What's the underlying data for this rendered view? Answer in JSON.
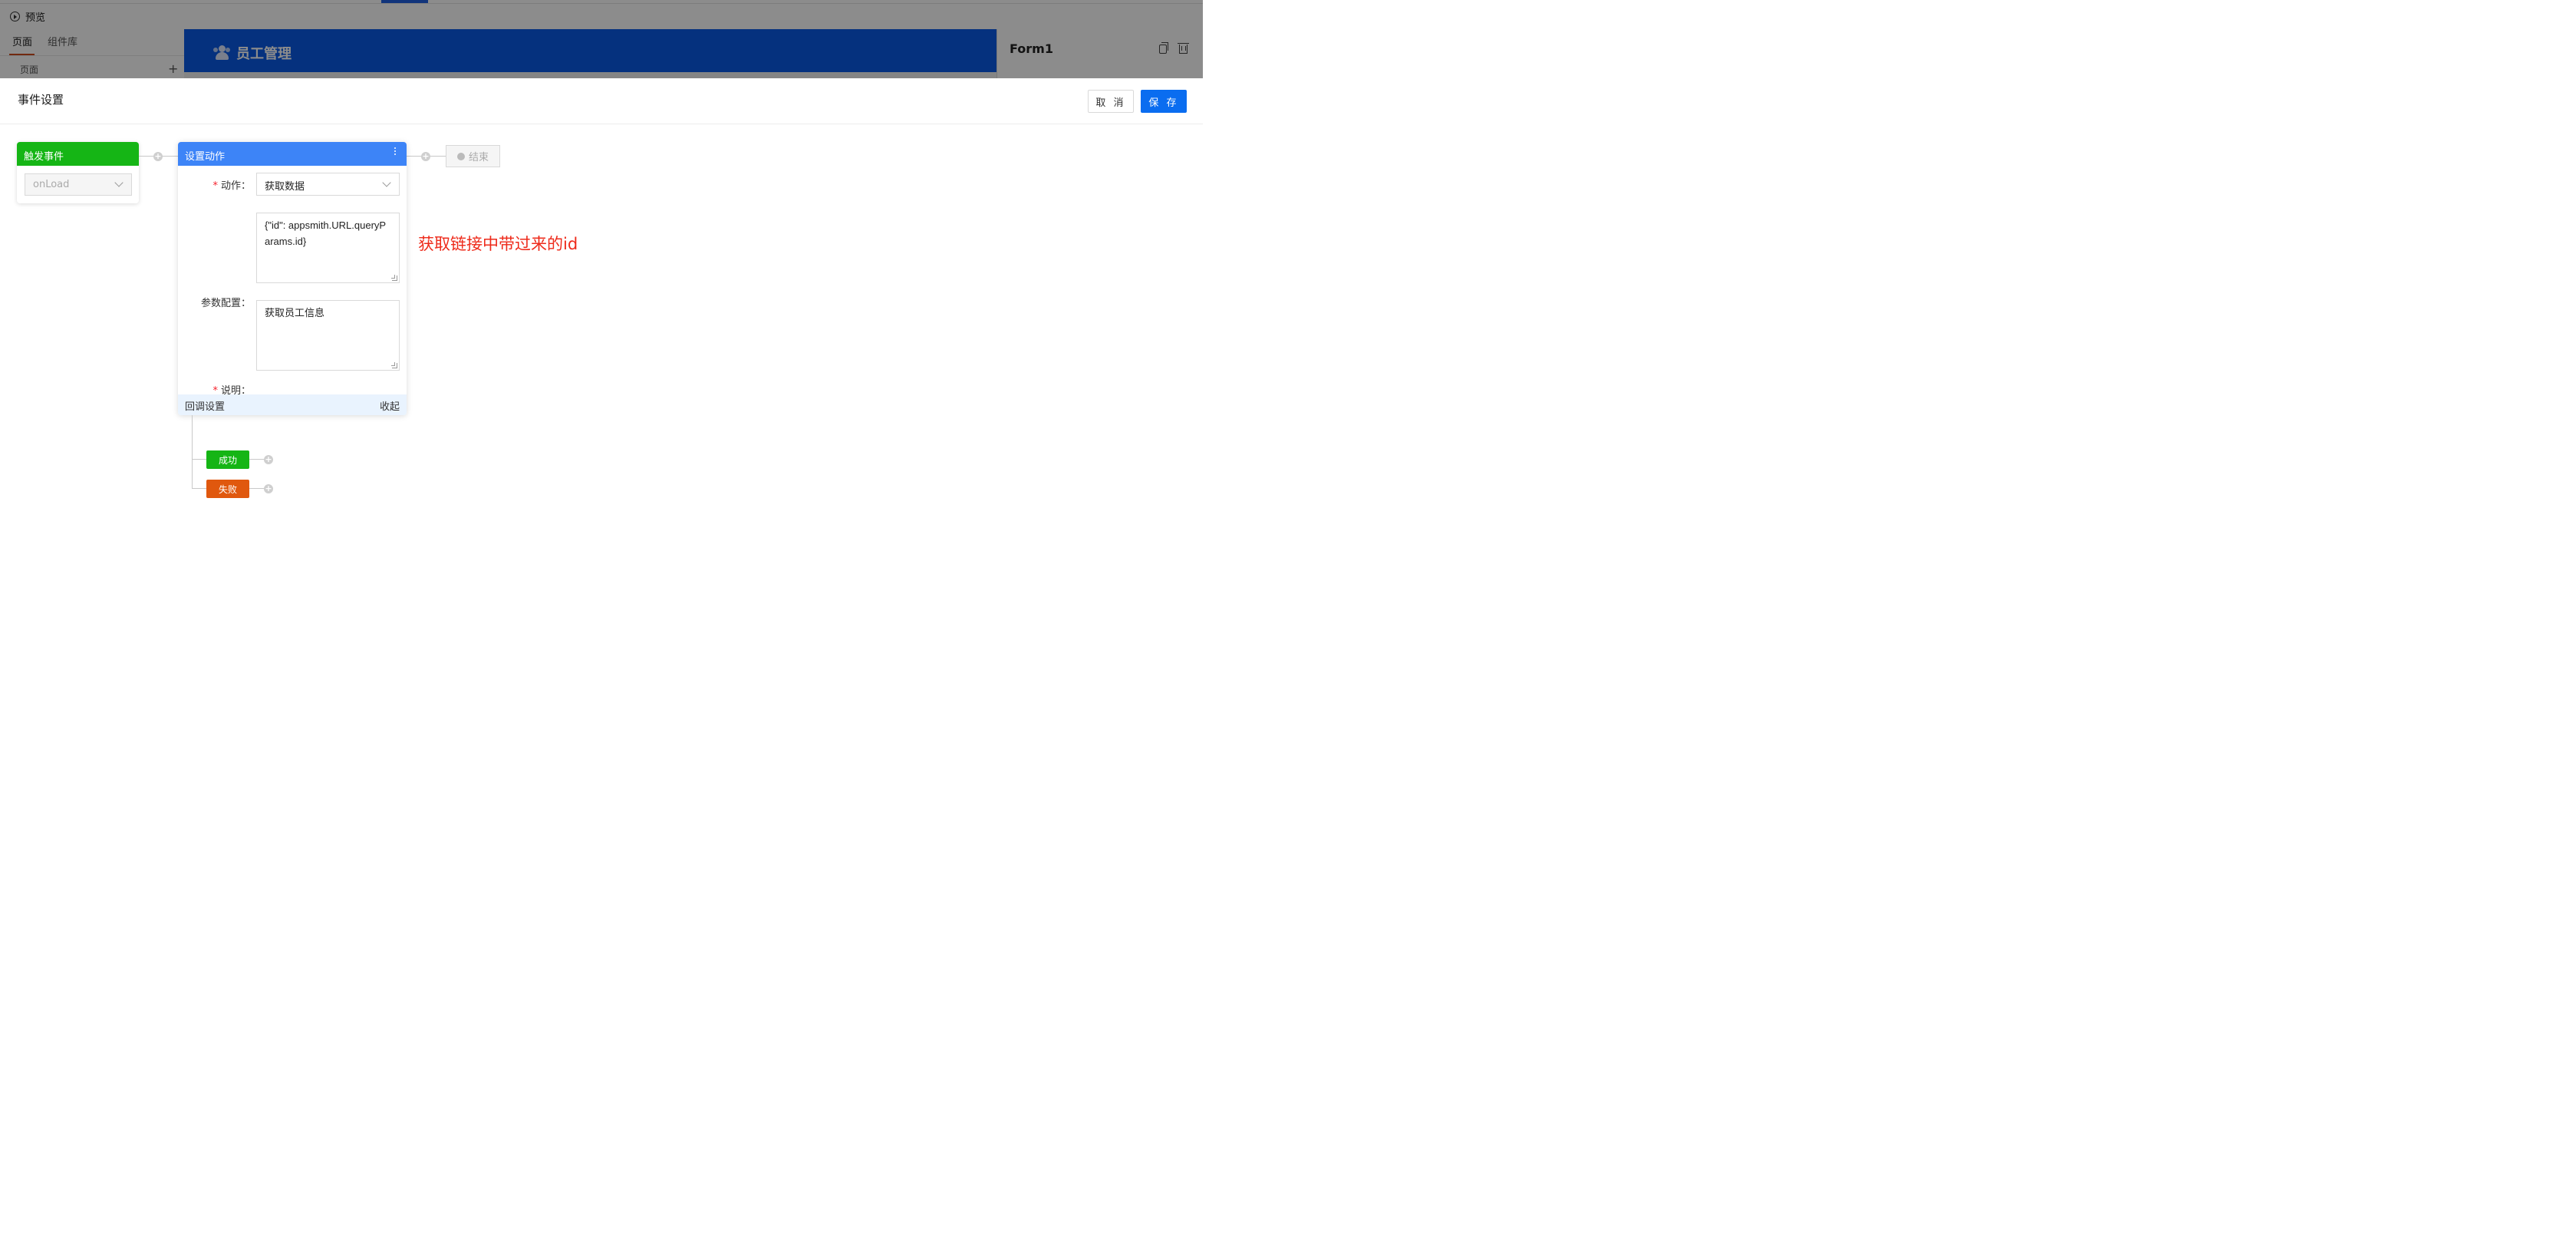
{
  "background": {
    "preview_label": "预览",
    "tabs": [
      "页面",
      "组件库"
    ],
    "pages_label": "页面",
    "add_symbol": "+",
    "canvas_title": "员工管理",
    "panel_title": "Form1"
  },
  "drawer": {
    "title": "事件设置",
    "cancel_label": "取 消",
    "save_label": "保 存"
  },
  "trigger": {
    "header": "触发事件",
    "event_value": "onLoad"
  },
  "action": {
    "header": "设置动作",
    "action_label": "动作",
    "action_value": "获取数据",
    "params_label": "参数配置",
    "params_value": "{\"id\": appsmith.URL.queryParams.id}",
    "desc_label": "说明",
    "desc_value": "获取员工信息",
    "callback_label": "回调设置",
    "collapse_label": "收起"
  },
  "end": {
    "label": "结束"
  },
  "callbacks": {
    "success": "成功",
    "fail": "失败"
  },
  "annotation": "获取链接中带过来的id",
  "colors": {
    "trigger_header": "#15b515",
    "action_header": "#3d84f7",
    "save_button": "#0a6df0",
    "success": "#15b515",
    "fail": "#e0580e",
    "annotation": "#ee2a1a"
  }
}
